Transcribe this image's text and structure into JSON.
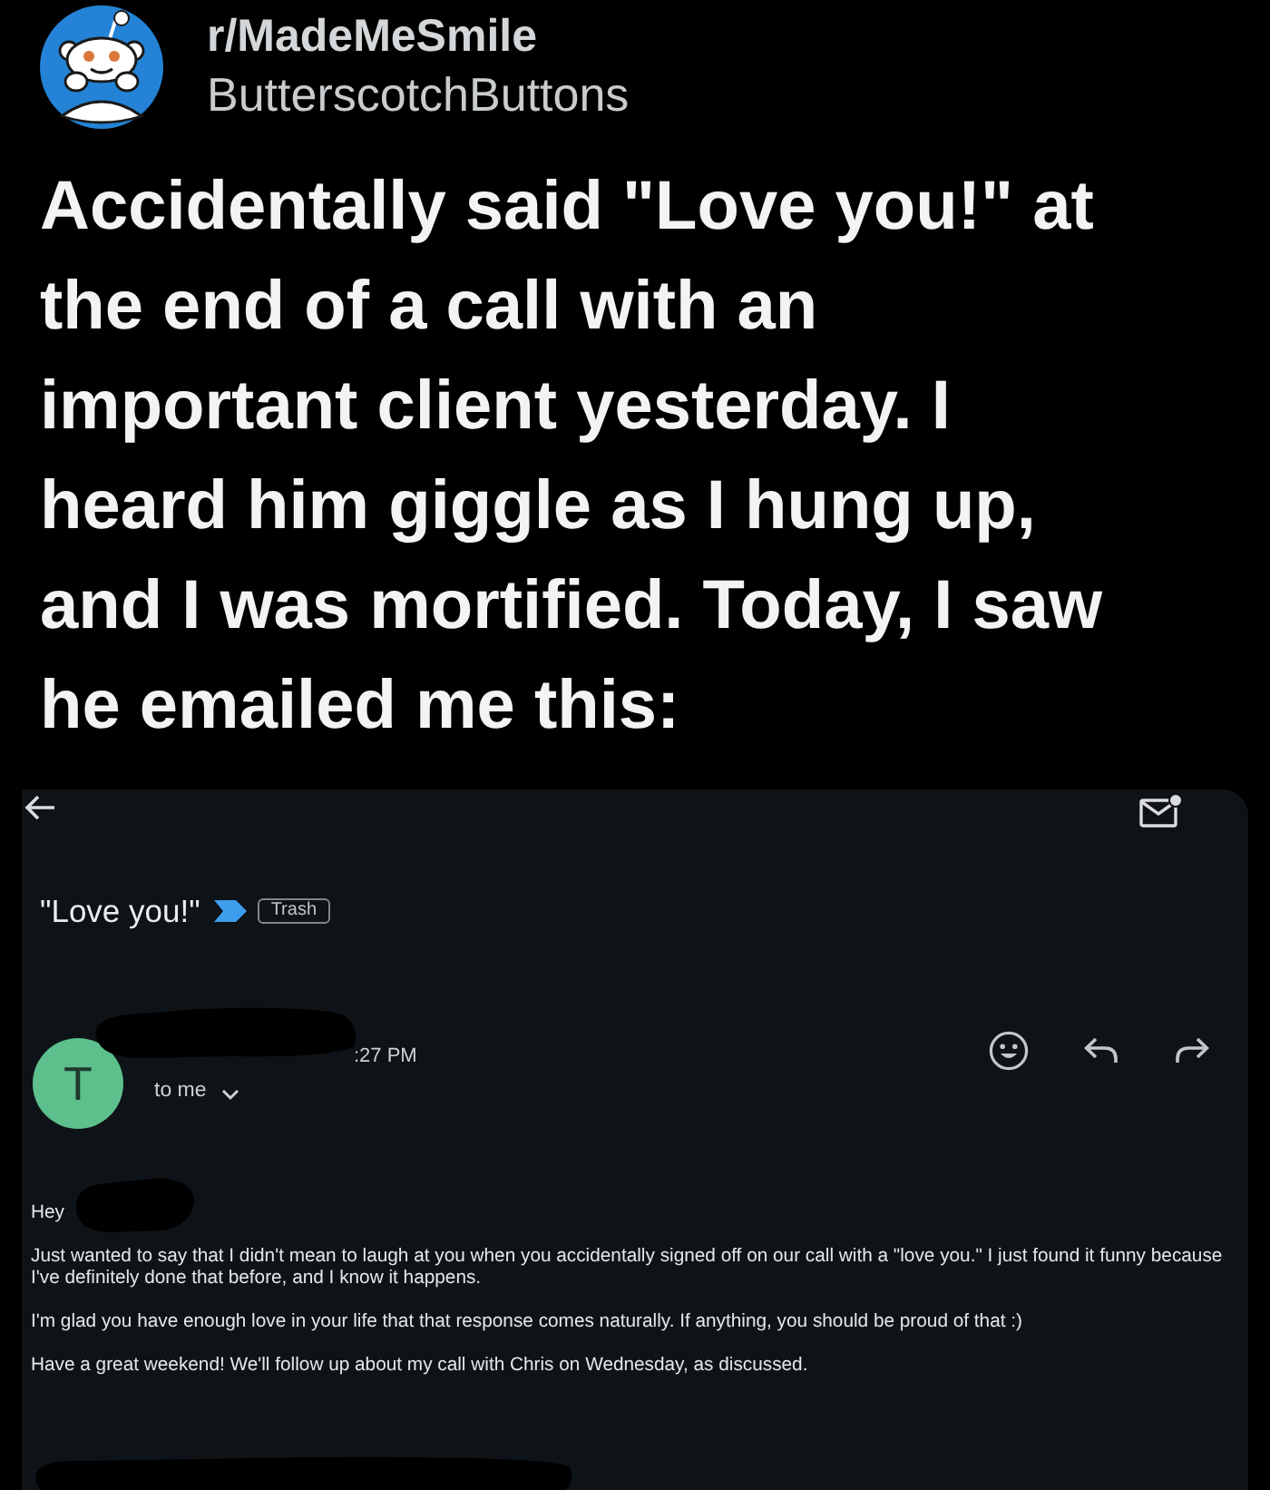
{
  "post": {
    "subreddit": "r/MadeMeSmile",
    "username": "ButterscotchButtons",
    "title": "Accidentally said \"Love you!\" at the end of a call with an important client yesterday. I heard him giggle as I hung up, and I was mortified. Today, I saw he emailed me this:"
  },
  "email": {
    "subject": "\"Love you!\"",
    "important": true,
    "label": "Trash",
    "sender_initial": "T",
    "time": ":27 PM",
    "recipient": "to me",
    "greeting": "Hey",
    "paragraphs": [
      "Just wanted to say that I didn't mean to laugh at you when you accidentally signed off on our call with a \"love you.\" I just found it funny because I've definitely done that before, and I know it happens.",
      "I'm glad you have enough love in your life that that response comes naturally. If anything, you should be proud of that :)",
      "Have a great weekend! We'll follow up about my call with Chris on Wednesday, as discussed."
    ]
  }
}
